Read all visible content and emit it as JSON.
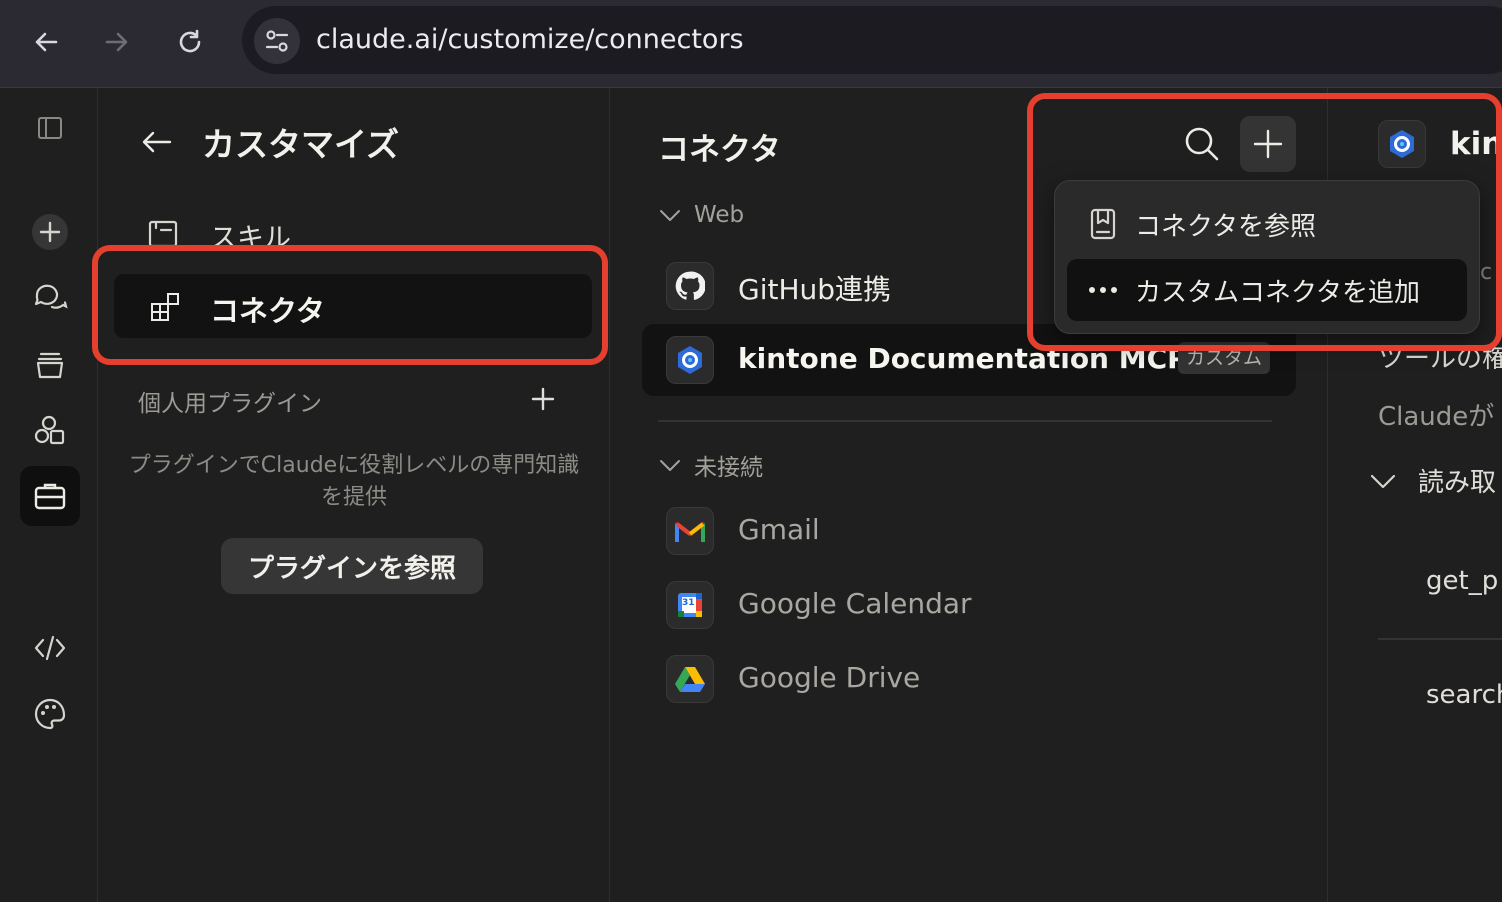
{
  "browser": {
    "url": "claude.ai/customize/connectors"
  },
  "rail": {
    "items": [
      "sidebar-toggle",
      "new-chat",
      "chats",
      "projects",
      "artifacts",
      "customize",
      "code",
      "appearance"
    ],
    "active": "customize"
  },
  "customize_panel": {
    "title": "カスタマイズ",
    "skills_label": "スキル",
    "connectors_label": "コネクタ",
    "plugins_heading": "個人用プラグイン",
    "plugins_description": "プラグインでClaudeに役割レベルの専門知識を提供",
    "browse_plugins_button": "プラグインを参照"
  },
  "connectors_panel": {
    "title": "コネクタ",
    "groups": [
      {
        "heading": "Web",
        "items": [
          {
            "name": "GitHub連携",
            "icon": "github-icon",
            "badge": ""
          },
          {
            "name": "kintone Documentation MCP…",
            "icon": "kintone-icon",
            "badge": "カスタム"
          }
        ]
      },
      {
        "heading": "未接続",
        "items": [
          {
            "name": "Gmail",
            "icon": "gmail-icon"
          },
          {
            "name": "Google Calendar",
            "icon": "google-calendar-icon",
            "calendar_day": "31"
          },
          {
            "name": "Google Drive",
            "icon": "google-drive-icon"
          }
        ]
      }
    ]
  },
  "add_menu": {
    "items": [
      {
        "label": "コネクタを参照",
        "icon": "book-icon"
      },
      {
        "label": "カスタムコネクタを追加",
        "icon": "more-dots-icon"
      }
    ]
  },
  "detail_panel": {
    "title_partial": "kin",
    "line1_partial": "ツールの権",
    "line2_partial": "Claudeが",
    "section_partial": "読み取",
    "tool1_partial": "get_p",
    "tool2_partial": "search",
    "edge_char": "c"
  },
  "colors": {
    "highlight_border": "#e5402f",
    "background": "#1f1f1f",
    "selected_row": "#121212",
    "kintone_blue": "#2f6bd8"
  }
}
